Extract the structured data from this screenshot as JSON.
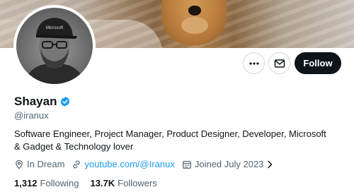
{
  "profile": {
    "display_name": "Shayan",
    "handle": "@iranux",
    "bio": "Software Engineer, Project Manager, Product Designer, Developer, Microsoft & Gadget & Technology lover",
    "location": "In Dream",
    "website": "youtube.com/@Iranux",
    "joined": "Joined July 2023",
    "avatar_cap_text": "Microsoft",
    "verified": true
  },
  "actions": {
    "follow_label": "Follow"
  },
  "stats": {
    "following_count": "1,312",
    "following_label": "Following",
    "followers_count": "13.7K",
    "followers_label": "Followers"
  },
  "colors": {
    "accent": "#1d9bf0",
    "primary_text": "#0f1419",
    "secondary_text": "#536471",
    "follow_button_bg": "#0f1419"
  },
  "icons": {
    "more": "more-horizontal-icon",
    "message": "envelope-icon",
    "verified": "verified-badge-icon",
    "location": "location-pin-icon",
    "link": "link-icon",
    "calendar": "calendar-icon",
    "chevron": "chevron-right-icon"
  }
}
